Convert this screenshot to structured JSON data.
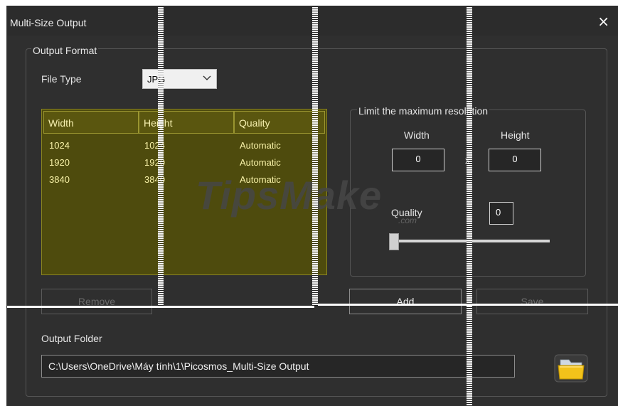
{
  "window": {
    "title": "Multi-Size Output",
    "close_glyph": "×"
  },
  "output_format": {
    "legend": "Output Format",
    "file_type_label": "File Type",
    "file_type_value": "JPG",
    "table": {
      "headers": [
        "Width",
        "Height",
        "Quality"
      ],
      "rows": [
        [
          "1024",
          "1024",
          "Automatic"
        ],
        [
          "1920",
          "1920",
          "Automatic"
        ],
        [
          "3840",
          "3840",
          "Automatic"
        ]
      ]
    },
    "buttons": {
      "remove": "Remove",
      "add": "Add",
      "save": "Save"
    }
  },
  "limit": {
    "legend": "Limit the maximum resolution",
    "width_label": "Width",
    "height_label": "Height",
    "width_value": "0",
    "height_value": "0",
    "separator": "x",
    "quality_label": "Quality",
    "quality_value": "0",
    "quality_level": 0
  },
  "output_folder": {
    "label": "Output Folder",
    "path": "C:\\Users\\OneDrive\\Máy tính\\1\\Picosmos_Multi-Size Output"
  },
  "watermark": {
    "text": "TipsMake",
    "suffix": ".com"
  },
  "colors": {
    "background": "#2f2f2f",
    "table_bg": "#4e4b0d",
    "table_text": "#f8f2a8",
    "folder": "#f2c21a"
  },
  "icons": [
    "close-icon",
    "chevron-down-icon",
    "folder-icon"
  ]
}
